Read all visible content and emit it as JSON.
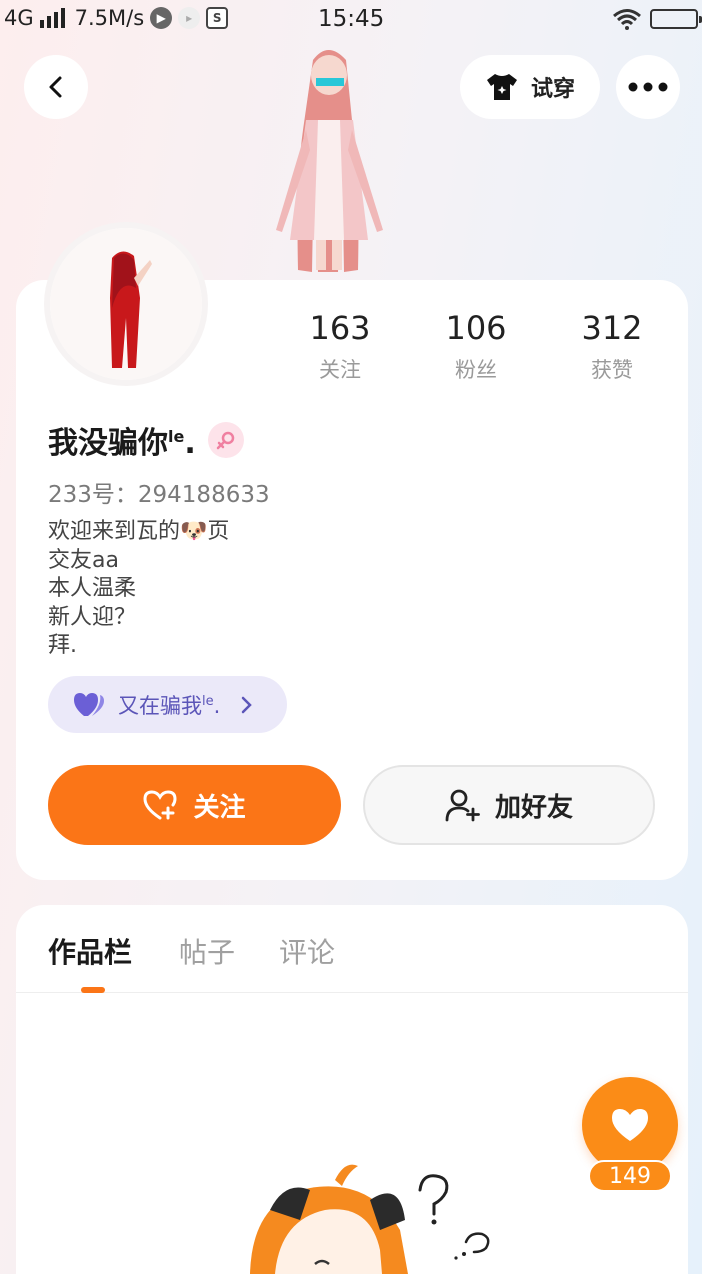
{
  "status_bar": {
    "network": "4G",
    "speed": "7.5M/s",
    "time": "15:45"
  },
  "header": {
    "tryon_label": "试穿"
  },
  "profile": {
    "username": "我没骗你",
    "username_suffix": "le",
    "username_end": ".",
    "uid": "233号：294188633",
    "stats": [
      {
        "value": "163",
        "label": "关注"
      },
      {
        "value": "106",
        "label": "粉丝"
      },
      {
        "value": "312",
        "label": "获赞"
      }
    ],
    "bio": [
      "欢迎来到瓦的🐶页",
      "交友aa",
      "本人温柔",
      "新人迎？",
      "拜."
    ],
    "club": {
      "name": "又在骗我",
      "suffix": "le",
      "end": "."
    },
    "follow_label": "关注",
    "add_friend_label": "加好友"
  },
  "tabs": [
    {
      "label": "作品栏",
      "active": true
    },
    {
      "label": "帖子",
      "active": false
    },
    {
      "label": "评论",
      "active": false
    }
  ],
  "like_float": {
    "count": "149"
  },
  "colors": {
    "accent": "#fb7517",
    "like": "#fb8c17",
    "club_bg": "#ebe9f9",
    "club_text": "#5b55b8",
    "gender_pink": "#f07fa0"
  }
}
